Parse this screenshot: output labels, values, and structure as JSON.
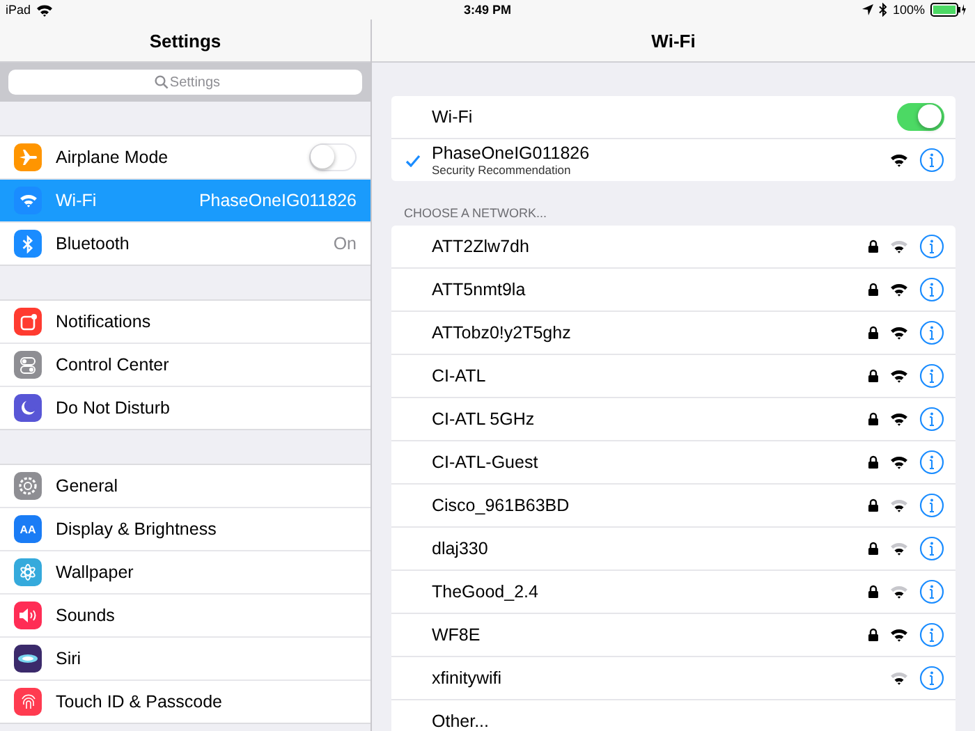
{
  "status_bar": {
    "device": "iPad",
    "time": "3:49 PM",
    "battery": "100%"
  },
  "sidebar": {
    "title": "Settings",
    "search": {
      "placeholder": "Settings"
    },
    "groups": [
      [
        {
          "label": "Airplane Mode",
          "kind": "toggle",
          "on": false,
          "selected": false,
          "color": "#ff9500"
        },
        {
          "label": "Wi-Fi",
          "kind": "value",
          "value": "PhaseOneIG011826",
          "selected": true,
          "color": "#1a8cff"
        },
        {
          "label": "Bluetooth",
          "kind": "value",
          "value": "On",
          "selected": false,
          "color": "#1a8cff"
        }
      ],
      [
        {
          "label": "Notifications",
          "kind": "plain",
          "selected": false,
          "color": "#ff3b30"
        },
        {
          "label": "Control Center",
          "kind": "plain",
          "selected": false,
          "color": "#8e8e93"
        },
        {
          "label": "Do Not Disturb",
          "kind": "plain",
          "selected": false,
          "color": "#5856d6"
        }
      ],
      [
        {
          "label": "General",
          "kind": "plain",
          "selected": false,
          "color": "#8e8e93"
        },
        {
          "label": "Display & Brightness",
          "kind": "plain",
          "selected": false,
          "color": "#1a7cf5",
          "icon_text": "AA"
        },
        {
          "label": "Wallpaper",
          "kind": "plain",
          "selected": false,
          "color": "#35aadc"
        },
        {
          "label": "Sounds",
          "kind": "plain",
          "selected": false,
          "color": "#ff2d55"
        },
        {
          "label": "Siri",
          "kind": "plain",
          "selected": false,
          "color": "#3b2a6b"
        },
        {
          "label": "Touch ID & Passcode",
          "kind": "plain",
          "selected": false,
          "color": "#ff3b50"
        }
      ]
    ]
  },
  "detail": {
    "title": "Wi-Fi",
    "wifi_toggle": {
      "label": "Wi-Fi",
      "on": true
    },
    "current": {
      "name": "PhaseOneIG011826",
      "subtitle": "Security Recommendation",
      "connected": true,
      "weak_signal": false
    },
    "section_header": "CHOOSE A NETWORK...",
    "networks": [
      {
        "name": "ATT2Zlw7dh",
        "locked": true,
        "weak_signal": true
      },
      {
        "name": "ATT5nmt9la",
        "locked": true,
        "weak_signal": false
      },
      {
        "name": "ATTobz0!y2T5ghz",
        "locked": true,
        "weak_signal": false
      },
      {
        "name": "CI-ATL",
        "locked": true,
        "weak_signal": false
      },
      {
        "name": "CI-ATL 5GHz",
        "locked": true,
        "weak_signal": false
      },
      {
        "name": "CI-ATL-Guest",
        "locked": true,
        "weak_signal": false
      },
      {
        "name": "Cisco_961B63BD",
        "locked": true,
        "weak_signal": true
      },
      {
        "name": "dlaj330",
        "locked": true,
        "weak_signal": true
      },
      {
        "name": "TheGood_2.4",
        "locked": true,
        "weak_signal": true
      },
      {
        "name": "WF8E",
        "locked": true,
        "weak_signal": false
      },
      {
        "name": "xfinitywifi",
        "locked": false,
        "weak_signal": true
      }
    ],
    "other": "Other..."
  }
}
